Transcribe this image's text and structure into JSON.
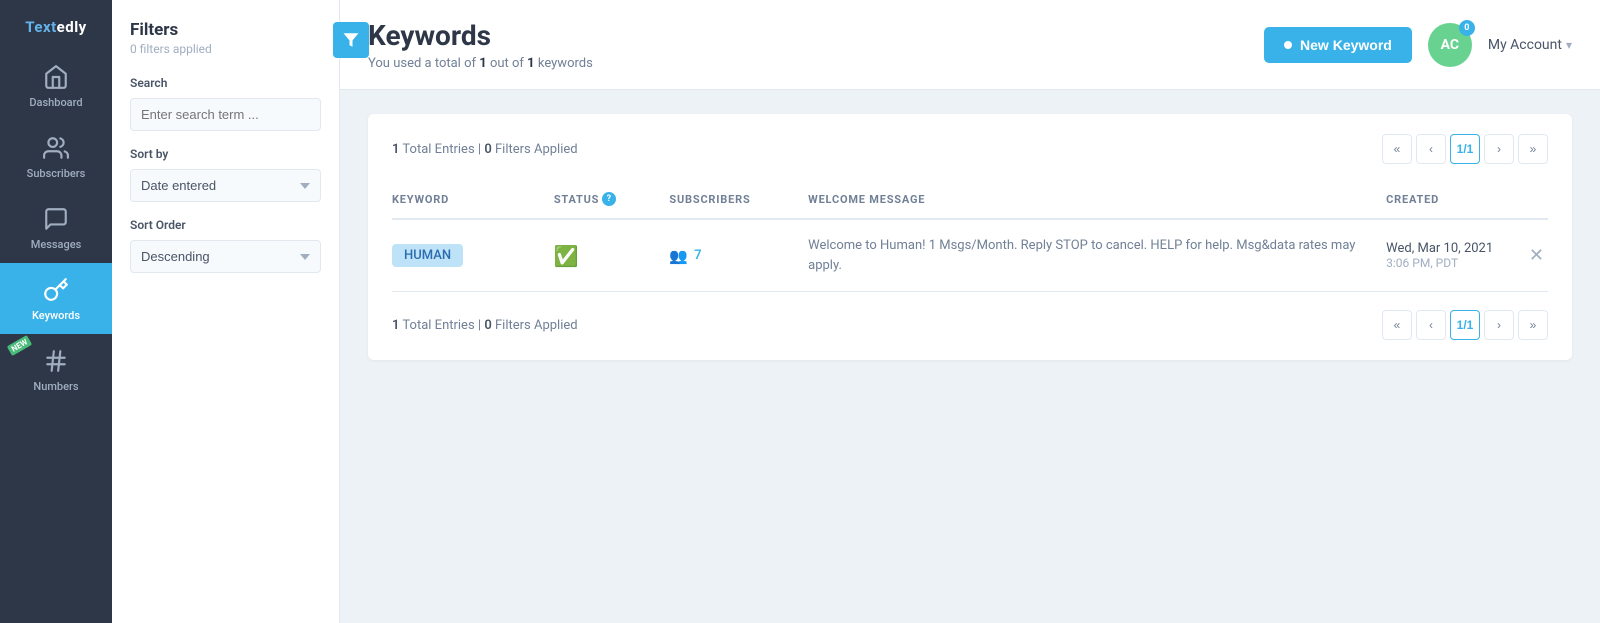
{
  "app": {
    "logo": "Textedly"
  },
  "sidebar": {
    "items": [
      {
        "id": "dashboard",
        "label": "Dashboard",
        "icon": "home"
      },
      {
        "id": "subscribers",
        "label": "Subscribers",
        "icon": "users"
      },
      {
        "id": "messages",
        "label": "Messages",
        "icon": "message"
      },
      {
        "id": "keywords",
        "label": "Keywords",
        "icon": "key",
        "active": true
      },
      {
        "id": "numbers",
        "label": "Numbers",
        "icon": "hash",
        "badge": "NEW"
      }
    ]
  },
  "filter_panel": {
    "title": "Filters",
    "subtitle": "0 filters applied",
    "search_label": "Search",
    "search_placeholder": "Enter search term ...",
    "sort_by_label": "Sort by",
    "sort_by_value": "Date entered",
    "sort_order_label": "Sort Order",
    "sort_order_value": "Descending"
  },
  "page_header": {
    "title": "Keywords",
    "subtitle_prefix": "You used a total of ",
    "used": "1",
    "out_of": "out of",
    "total": "1",
    "suffix": "keywords",
    "new_keyword_button": "New Keyword",
    "avatar_initials": "AC",
    "avatar_badge": "0",
    "my_account": "My Account"
  },
  "table": {
    "top_meta": {
      "entries": "1",
      "entries_label": "Total Entries",
      "filters": "0",
      "filters_label": "Filters Applied"
    },
    "pagination_top": {
      "current": "1/1"
    },
    "columns": [
      {
        "id": "keyword",
        "label": "KEYWORD"
      },
      {
        "id": "status",
        "label": "STATUS"
      },
      {
        "id": "subscribers",
        "label": "SUBSCRIBERS"
      },
      {
        "id": "welcome_message",
        "label": "WELCOME MESSAGE"
      },
      {
        "id": "created",
        "label": "CREATED"
      }
    ],
    "rows": [
      {
        "keyword": "HUMAN",
        "status": "active",
        "subscribers": "7",
        "welcome_message": "Welcome to Human! 1 Msgs/Month. Reply STOP to cancel. HELP for help. Msg&data rates may apply.",
        "created_date": "Wed, Mar 10, 2021",
        "created_time": "3:06 PM, PDT"
      }
    ],
    "bottom_meta": {
      "entries": "1",
      "entries_label": "Total Entries",
      "filters": "0",
      "filters_label": "Filters Applied"
    },
    "pagination_bottom": {
      "current": "1/1"
    }
  }
}
